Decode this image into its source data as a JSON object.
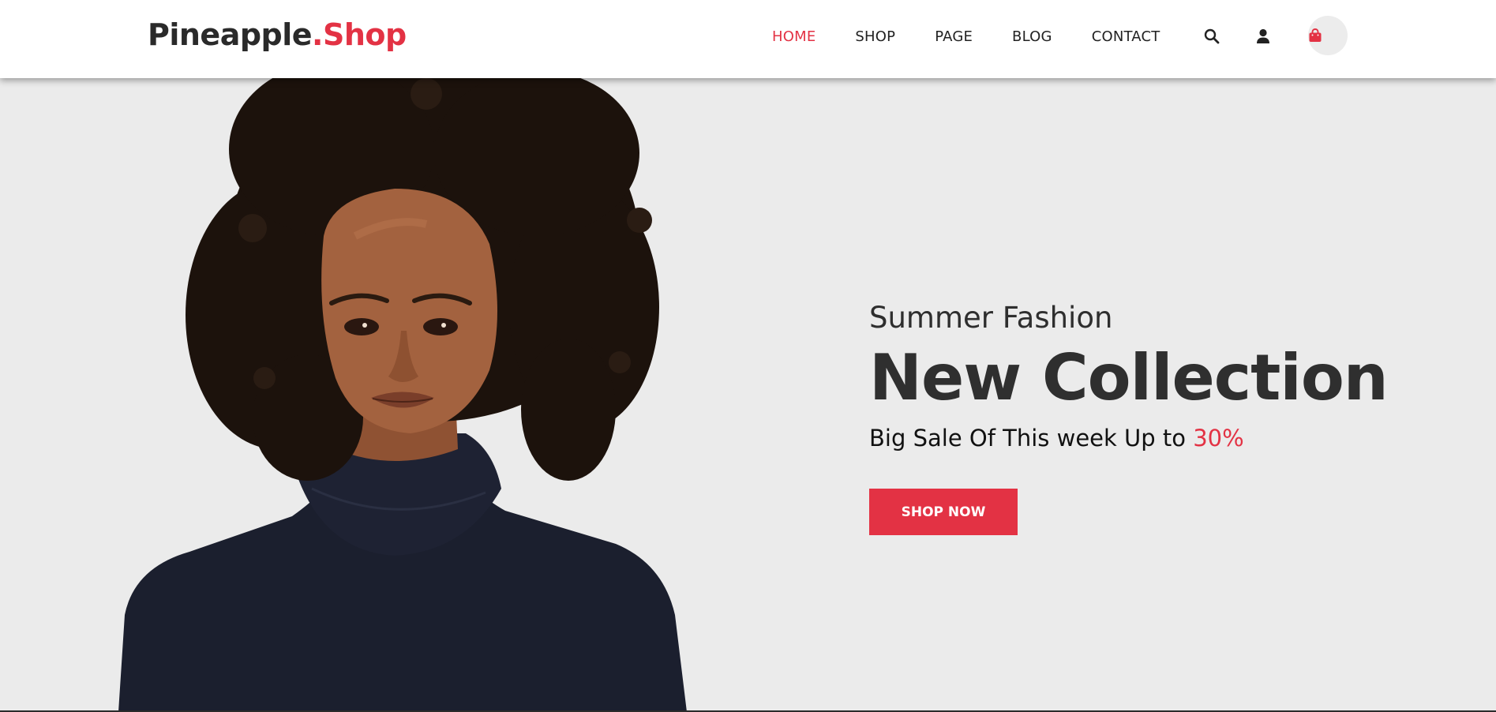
{
  "header": {
    "logo_main": "Pineapple",
    "logo_accent": ".Shop",
    "nav": [
      {
        "label": "HOME",
        "active": true
      },
      {
        "label": "SHOP",
        "active": false
      },
      {
        "label": "PAGE",
        "active": false
      },
      {
        "label": "BLOG",
        "active": false
      },
      {
        "label": "CONTACT",
        "active": false
      }
    ],
    "icons": [
      "search-icon",
      "user-icon",
      "shopping-bag-icon"
    ]
  },
  "hero": {
    "subtitle": "Summer Fashion",
    "title": "New Collection",
    "sale_text": "Big Sale Of This week Up to ",
    "sale_percent": "30%",
    "button_label": "SHOP NOW"
  },
  "colors": {
    "accent": "#e33244",
    "text_dark": "#2f2f2f",
    "hero_background": "#ebebeb",
    "sweater": "#1b1f2e",
    "hair": "#1c120c",
    "skin": "#a3623f"
  }
}
